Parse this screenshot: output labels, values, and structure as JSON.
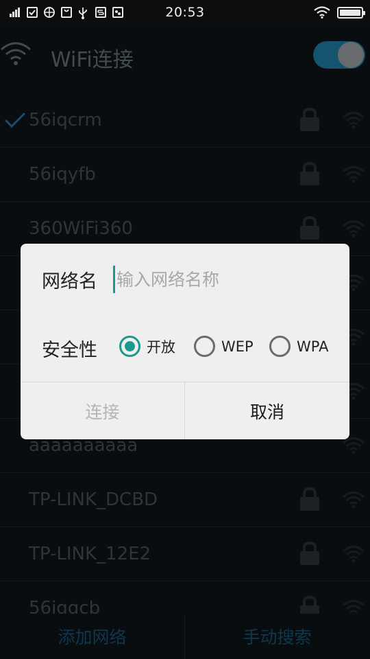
{
  "status_bar": {
    "time": "20:53",
    "icons": [
      "signal-bars-icon",
      "checkbox-notif-icon",
      "globe-icon",
      "bag-icon",
      "usb-icon",
      "s-app-icon",
      "app-notif-icon"
    ],
    "battery_level": 1.0
  },
  "header": {
    "title": "WiFi连接",
    "toggle_on": true,
    "accent_color": "#1d6f95"
  },
  "networks": [
    {
      "name": "56iqcrm",
      "connected": true,
      "locked": true
    },
    {
      "name": "56iqyfb",
      "connected": false,
      "locked": true
    },
    {
      "name": "360WiFi360",
      "connected": false,
      "locked": true
    },
    {
      "name": "",
      "connected": false,
      "locked": true
    },
    {
      "name": "",
      "connected": false,
      "locked": true
    },
    {
      "name": "",
      "connected": false,
      "locked": true
    },
    {
      "name": "aaaaaaaaaa",
      "connected": false,
      "locked": false
    },
    {
      "name": "TP-LINK_DCBD",
      "connected": false,
      "locked": true
    },
    {
      "name": "TP-LINK_12E2",
      "connected": false,
      "locked": true
    },
    {
      "name": "56iqgcb",
      "connected": false,
      "locked": true
    }
  ],
  "bottom_bar": {
    "add_network": "添加网络",
    "manual_search": "手动搜索"
  },
  "dialog": {
    "name_label": "网络名",
    "name_value": "",
    "name_placeholder": "输入网络名称",
    "security_label": "安全性",
    "options": [
      {
        "label": "开放",
        "checked": true
      },
      {
        "label": "WEP",
        "checked": false
      },
      {
        "label": "WPA",
        "checked": false
      }
    ],
    "connect_label": "连接",
    "cancel_label": "取消",
    "accent_color": "#1a9a8c"
  }
}
